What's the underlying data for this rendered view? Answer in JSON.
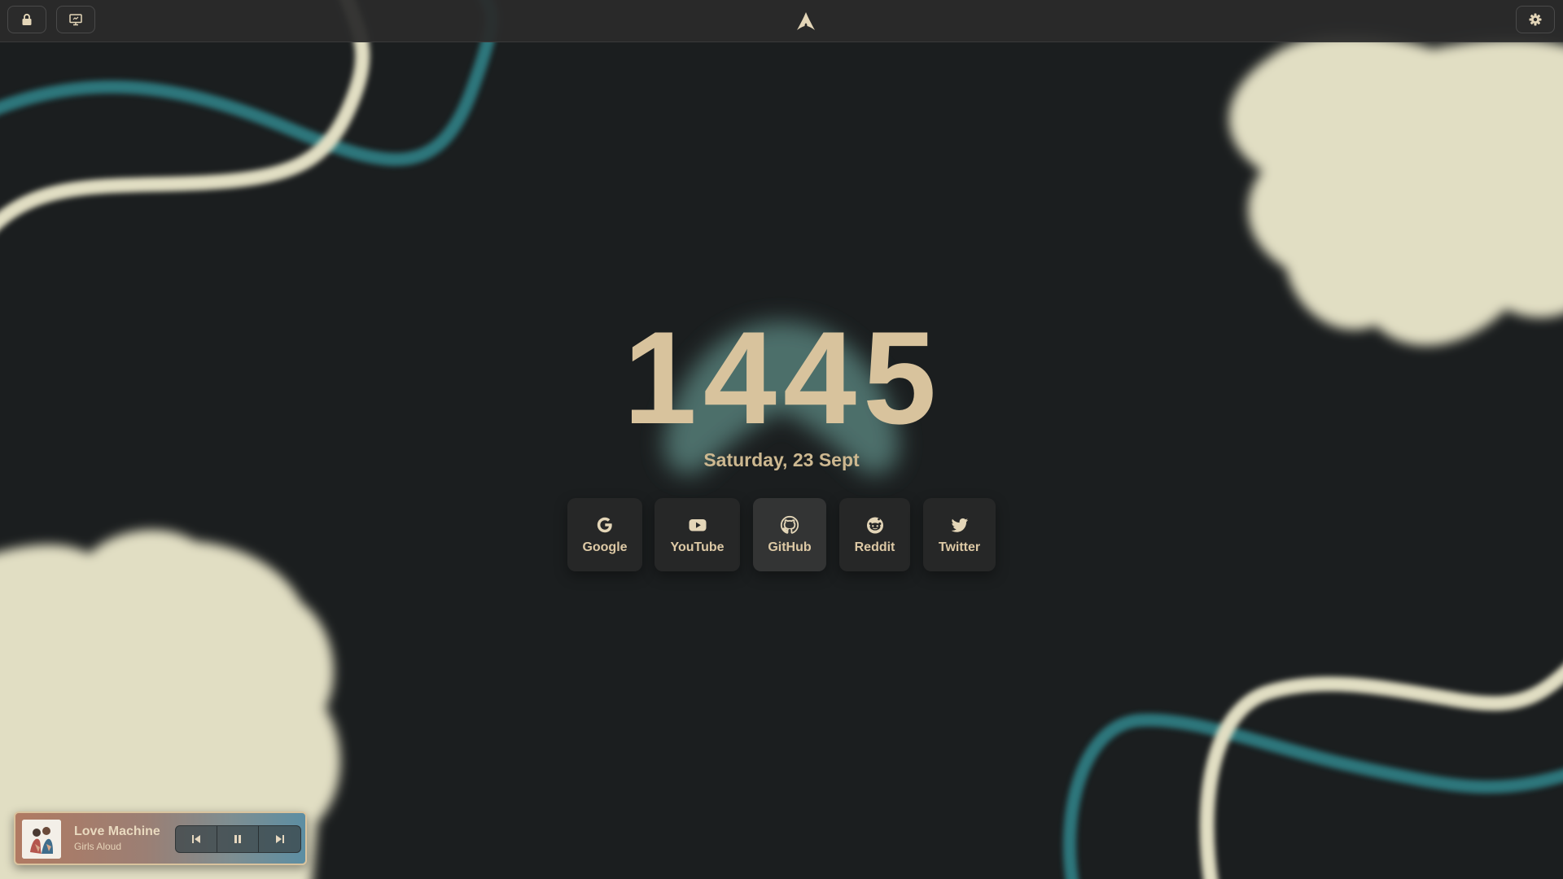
{
  "topbar": {
    "left_buttons": [
      {
        "icon": "lock-icon"
      },
      {
        "icon": "monitor-icon"
      }
    ],
    "center_logo": "arch-logo-icon",
    "right_button": {
      "icon": "gear-icon"
    }
  },
  "clock": {
    "time": "1445"
  },
  "date": {
    "text": "Saturday, 23 Sept"
  },
  "shortcuts": [
    {
      "label": "Google",
      "icon": "google-icon"
    },
    {
      "label": "YouTube",
      "icon": "youtube-icon"
    },
    {
      "label": "GitHub",
      "icon": "github-icon"
    },
    {
      "label": "Reddit",
      "icon": "reddit-icon"
    },
    {
      "label": "Twitter",
      "icon": "twitter-icon"
    }
  ],
  "player": {
    "title": "Love Machine",
    "artist": "Girls Aloud",
    "controls": [
      "previous-icon",
      "pause-icon",
      "next-icon"
    ]
  },
  "colors": {
    "background": "#1b1e1f",
    "cream": "#e1dec3",
    "teal": "#2f7c81",
    "accent_text": "#d8c39d"
  }
}
